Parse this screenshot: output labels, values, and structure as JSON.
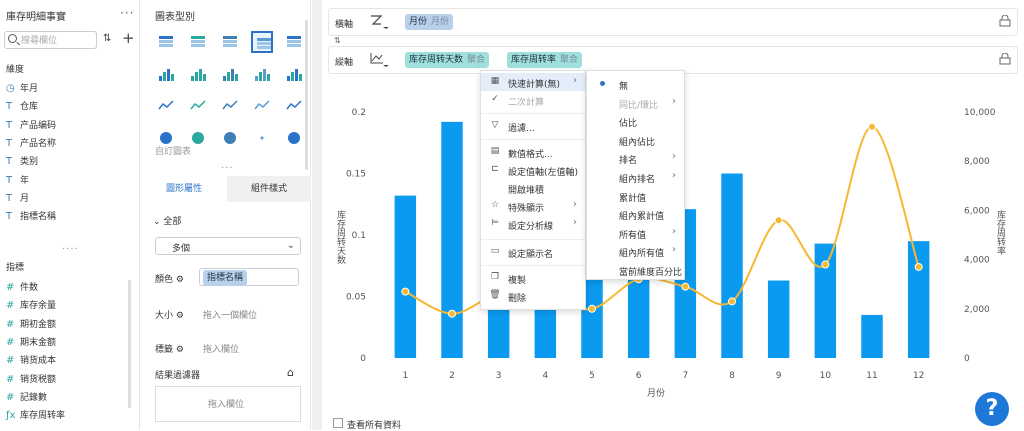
{
  "fields_panel": {
    "title": "庫存明細事實",
    "more": "···",
    "search_placeholder": "搜尋欄位",
    "dimension_header": "維度",
    "dimensions": [
      {
        "icon": "clock-icon",
        "label": "年月"
      },
      {
        "icon": "text-field-icon",
        "label": "仓库"
      },
      {
        "icon": "text-field-icon",
        "label": "产品编码"
      },
      {
        "icon": "text-field-icon",
        "label": "产品名称"
      },
      {
        "icon": "text-field-icon",
        "label": "类别"
      },
      {
        "icon": "text-field-icon",
        "label": "年"
      },
      {
        "icon": "text-field-icon",
        "label": "月"
      },
      {
        "icon": "text-field-icon",
        "label": "指標名稱"
      }
    ],
    "measure_header": "指標",
    "measures": [
      {
        "icon": "hash-icon",
        "label": "件数"
      },
      {
        "icon": "hash-icon",
        "label": "库存余量"
      },
      {
        "icon": "hash-icon",
        "label": "期初金额"
      },
      {
        "icon": "hash-icon",
        "label": "期末金额"
      },
      {
        "icon": "hash-icon",
        "label": "销货成本"
      },
      {
        "icon": "hash-icon",
        "label": "销货税额"
      },
      {
        "icon": "hash-icon",
        "label": "記錄數"
      },
      {
        "icon": "formula-icon",
        "label": "库存周转率"
      }
    ]
  },
  "chart_panel": {
    "title": "圖表型別",
    "custom_label": "自訂圖表",
    "tab_properties": "圖形屬性",
    "tab_styles": "組件樣式",
    "all_label": "全部",
    "multi_select": "多個",
    "color_label": "顏色",
    "color_pill": "指標名稱",
    "size_label": "大小",
    "size_hint": "拖入一個欄位",
    "tag_label": "標籤",
    "tag_hint": "拖入欄位",
    "filter_label": "結果過濾器",
    "filter_hint": "拖入欄位"
  },
  "axes": {
    "x_name": "橫軸",
    "x_pill": "月份",
    "x_pill_sub": "月份",
    "y_name": "縱軸",
    "y_pill1": "库存周转天数",
    "y_pill1_sub": "聚合",
    "y_pill2": "库存周转率",
    "y_pill2_sub": "聚合"
  },
  "context_menu": {
    "items": [
      {
        "icon": "grid-icon",
        "label": "快速計算(無)",
        "arrow": true,
        "disabled": false
      },
      {
        "icon": "check-icon",
        "label": "二次計算",
        "arrow": false,
        "disabled": true
      },
      {
        "icon": "filter-icon",
        "label": "過濾...",
        "arrow": false,
        "disabled": false
      },
      {
        "icon": "number-format-icon",
        "label": "數值格式...",
        "arrow": false,
        "disabled": false
      },
      {
        "icon": "axis-icon",
        "label": "設定值軸(左值軸)",
        "arrow": false,
        "disabled": false
      },
      {
        "icon": "",
        "label": "開啟堆積",
        "arrow": false,
        "disabled": false
      },
      {
        "icon": "star-icon",
        "label": "特殊顯示",
        "arrow": true,
        "disabled": false
      },
      {
        "icon": "analysis-line-icon",
        "label": "設定分析線",
        "arrow": true,
        "disabled": false
      },
      {
        "icon": "display-name-icon",
        "label": "設定顯示名",
        "arrow": false,
        "disabled": false
      },
      {
        "icon": "copy-icon",
        "label": "複製",
        "arrow": false,
        "disabled": false
      },
      {
        "icon": "trash-icon",
        "label": "刪除",
        "arrow": false,
        "disabled": false
      }
    ]
  },
  "submenu": {
    "items": [
      {
        "label": "無",
        "arrow": false,
        "disabled": false,
        "selected": true
      },
      {
        "label": "同比/環比",
        "arrow": true,
        "disabled": true,
        "selected": false
      },
      {
        "label": "佔比",
        "arrow": false,
        "disabled": false,
        "selected": false
      },
      {
        "label": "組內佔比",
        "arrow": false,
        "disabled": false,
        "selected": false
      },
      {
        "label": "排名",
        "arrow": true,
        "disabled": false,
        "selected": false
      },
      {
        "label": "組內排名",
        "arrow": true,
        "disabled": false,
        "selected": false
      },
      {
        "label": "累計值",
        "arrow": false,
        "disabled": false,
        "selected": false
      },
      {
        "label": "組內累計值",
        "arrow": false,
        "disabled": false,
        "selected": false
      },
      {
        "label": "所有值",
        "arrow": true,
        "disabled": false,
        "selected": false
      },
      {
        "label": "組內所有值",
        "arrow": true,
        "disabled": false,
        "selected": false
      },
      {
        "label": "當前維度百分比",
        "arrow": false,
        "disabled": false,
        "selected": false
      }
    ]
  },
  "show_all_label": "查看所有資料",
  "help_label": "?",
  "colors": {
    "bar": "#0a9af0",
    "line": "#f6b731",
    "accent": "#2a73c9"
  },
  "chart_data": {
    "type": "bar",
    "categories": [
      "1",
      "2",
      "3",
      "4",
      "5",
      "6",
      "7",
      "8",
      "9",
      "10",
      "11",
      "12"
    ],
    "xlabel": "月份",
    "ylabel": "库存周转天数",
    "y2label": "库存周转率",
    "ylim": [
      0,
      0.2
    ],
    "y2lim": [
      0,
      10000
    ],
    "yticks": [
      "0",
      "0.05",
      "0.1",
      "0.15",
      "0.2"
    ],
    "y2ticks": [
      "0",
      "2,000",
      "4,000",
      "6,000",
      "8,000",
      "10,000"
    ],
    "series": [
      {
        "values": [
          0.132,
          0.192,
          0.163,
          0.065,
          0.065,
          0.155,
          0.121,
          0.15,
          0.063,
          0.093,
          0.035,
          0.095
        ]
      },
      {
        "values": [
          2700,
          1800,
          2600,
          2400,
          2000,
          3200,
          2900,
          2300,
          5600,
          3800,
          9400,
          3700
        ]
      }
    ]
  }
}
